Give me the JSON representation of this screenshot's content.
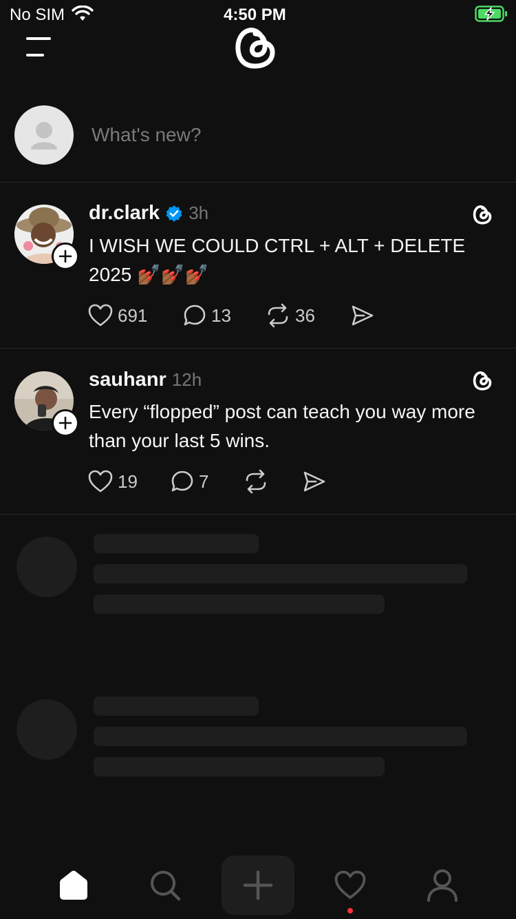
{
  "status": {
    "carrier": "No SIM",
    "time": "4:50 PM"
  },
  "compose": {
    "placeholder": "What's new?"
  },
  "posts": [
    {
      "username": "dr.clark",
      "time": "3h",
      "verified": true,
      "text": "I WISH WE COULD CTRL + ALT + DELETE 2025 💅🏾💅🏾💅🏾",
      "likes": "691",
      "replies": "13",
      "reposts": "36"
    },
    {
      "username": "sauhanr",
      "time": "12h",
      "verified": false,
      "text": "Every “flopped” post can teach you way more than your last 5 wins.",
      "likes": "19",
      "replies": "7",
      "reposts": ""
    }
  ],
  "icons": {
    "menu": "menu-icon",
    "logo": "threads-logo-icon",
    "like": "heart-icon",
    "reply": "comment-icon",
    "repost": "repost-icon",
    "share": "send-icon",
    "home": "home-icon",
    "search": "search-icon",
    "create": "plus-icon",
    "activity": "heart-icon",
    "profile": "profile-icon"
  },
  "colors": {
    "background": "#101010",
    "verified": "#0095f6",
    "notification_dot": "#ff3040",
    "battery": "#4cd964"
  }
}
